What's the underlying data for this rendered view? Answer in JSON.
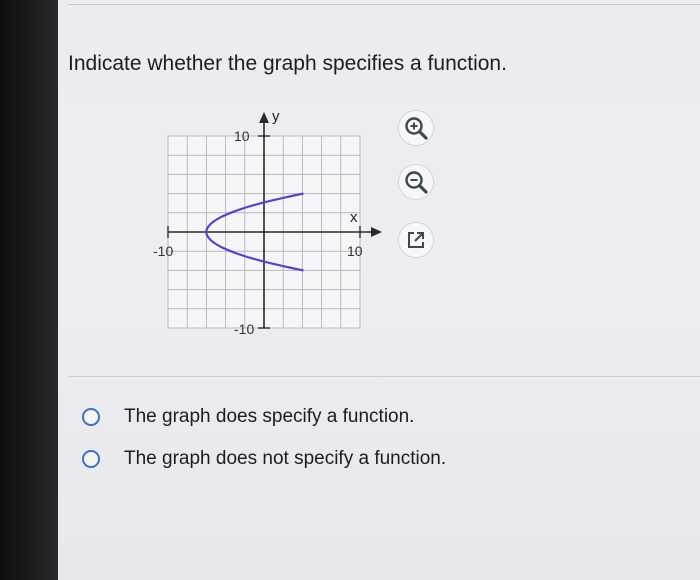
{
  "question": "Indicate whether the graph specifies a function.",
  "graph": {
    "x_label": "x",
    "y_label": "y",
    "y_max_label": "10",
    "y_min_label": "-10",
    "x_min_label": "-10",
    "x_max_label": "10",
    "curve_color": "#5046c8"
  },
  "tools": {
    "zoom_in": "zoom-in-icon",
    "zoom_out": "zoom-out-icon",
    "popout": "external-link-icon"
  },
  "options": [
    {
      "label": "The graph does specify a function."
    },
    {
      "label": "The graph does not specify a function."
    }
  ],
  "accent_color": "#3a72c8"
}
